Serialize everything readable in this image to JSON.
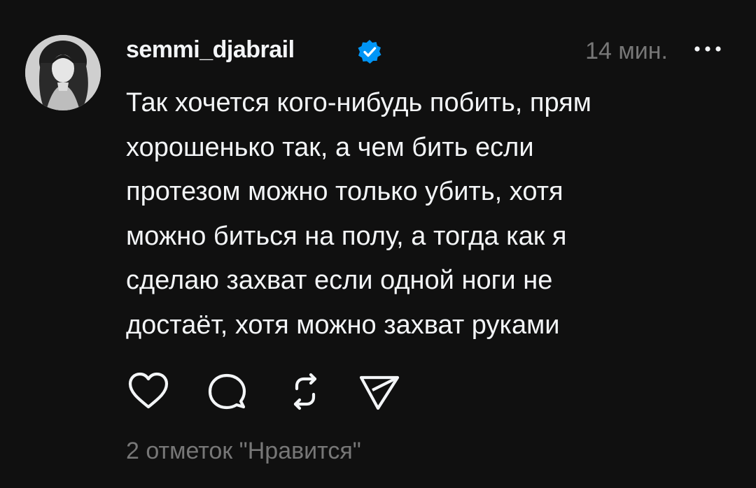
{
  "post": {
    "username": "semmi_djabrail",
    "verified": true,
    "timestamp": "14 мин.",
    "text": "Так хочется кого-нибудь побить, прям\nхорошенько так, а чем бить если\nпротезом можно только убить, хотя\nможно биться на полу, а тогда как я\nсделаю захват если одной ноги не\nдостаёт, хотя можно захват руками",
    "likes_text": "2 отметок \"Нравится\""
  },
  "icons": {
    "avatar": "profile-photo",
    "verified": "verified-badge-icon",
    "more": "more-options-icon",
    "like": "heart-icon",
    "comment": "comment-icon",
    "repost": "repost-icon",
    "share": "send-icon"
  },
  "colors": {
    "background": "#101010",
    "text": "#f3f5f7",
    "muted": "#777777",
    "verified": "#0095f6"
  }
}
